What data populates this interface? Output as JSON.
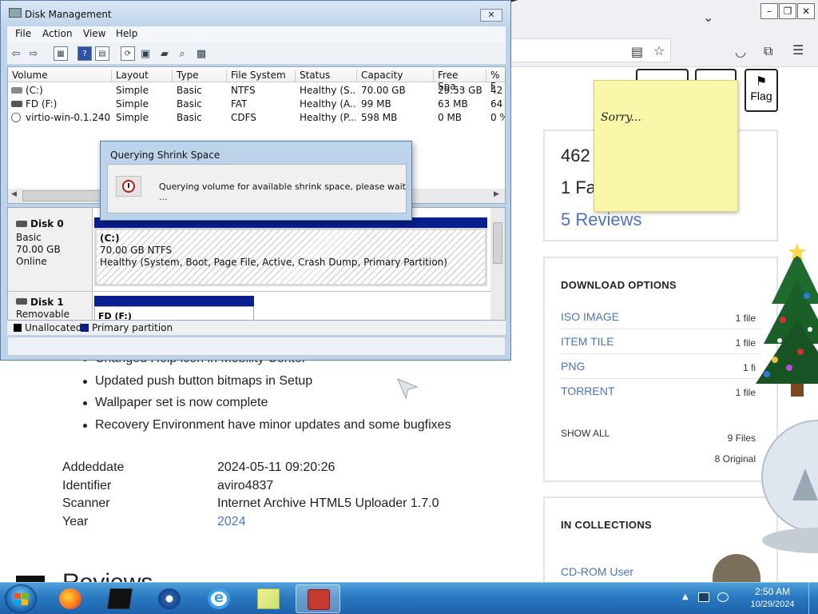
{
  "browser": {
    "flag_label": "Flag",
    "bullets": [
      "Changed Help icon in Mobility Center",
      "Updated push button bitmaps in Setup",
      "Wallpaper set is now complete",
      "Recovery Environment have minor updates and some bugfixes"
    ],
    "metadata": [
      {
        "key": "Addeddate",
        "value": "2024-05-11 09:20:26"
      },
      {
        "key": "Identifier",
        "value": "aviro4837"
      },
      {
        "key": "Scanner",
        "value": "Internet Archive HTML5 Uploader 1.7.0"
      },
      {
        "key": "Year",
        "value": "2024"
      }
    ],
    "reviews_heading": "Reviews",
    "stats": {
      "views": "462",
      "favorites": "1 Fa",
      "reviews_link": "5 Reviews"
    },
    "download": {
      "title": "DOWNLOAD OPTIONS",
      "options": [
        {
          "label": "ISO IMAGE",
          "count": "1 file"
        },
        {
          "label": "ITEM TILE",
          "count": "1 file"
        },
        {
          "label": "PNG",
          "count": "1 fi"
        },
        {
          "label": "TORRENT",
          "count": "1 file"
        }
      ],
      "show_all": "SHOW ALL",
      "files": "9 Files",
      "original": "8 Original"
    },
    "collections": {
      "title": "IN COLLECTIONS",
      "item": "CD-ROM User"
    }
  },
  "sticky_note": {
    "text": "Sorry..."
  },
  "disk_mgmt": {
    "title": "Disk Management",
    "close_label": "✕",
    "menu": [
      "File",
      "Action",
      "View",
      "Help"
    ],
    "columns": [
      "Volume",
      "Layout",
      "Type",
      "File System",
      "Status",
      "Capacity",
      "Free Spa...",
      "% F"
    ],
    "volumes": [
      {
        "volume": "(C:)",
        "layout": "Simple",
        "type": "Basic",
        "fs": "NTFS",
        "status": "Healthy (S...",
        "capacity": "70.00 GB",
        "free": "29.53 GB",
        "pct": "42"
      },
      {
        "volume": "FD (F:)",
        "layout": "Simple",
        "type": "Basic",
        "fs": "FAT",
        "status": "Healthy (A...",
        "capacity": "99 MB",
        "free": "63 MB",
        "pct": "64"
      },
      {
        "volume": "virtio-win-0.1.240 ...",
        "layout": "Simple",
        "type": "Basic",
        "fs": "CDFS",
        "status": "Healthy (P...",
        "capacity": "598 MB",
        "free": "0 MB",
        "pct": "0 %"
      }
    ],
    "disk0": {
      "name": "Disk 0",
      "kind": "Basic",
      "size": "70.00 GB",
      "state": "Online"
    },
    "disk0_part": {
      "label": "(C:)",
      "size_fs": "70.00 GB NTFS",
      "status": "Healthy (System, Boot, Page File, Active, Crash Dump, Primary Partition)"
    },
    "disk1": {
      "name": "Disk 1",
      "kind": "Removable"
    },
    "disk1_part": {
      "label": "FD  (F:)"
    },
    "legend": [
      {
        "label": "Unallocated",
        "color": "#000000"
      },
      {
        "label": "Primary partition",
        "color": "#0a1f8f"
      }
    ]
  },
  "dialog": {
    "title": "Querying Shrink Space",
    "message": "Querying volume for available shrink space, please wait ..."
  },
  "taskbar": {
    "time": "2:50 AM",
    "date": "10/29/2024"
  }
}
